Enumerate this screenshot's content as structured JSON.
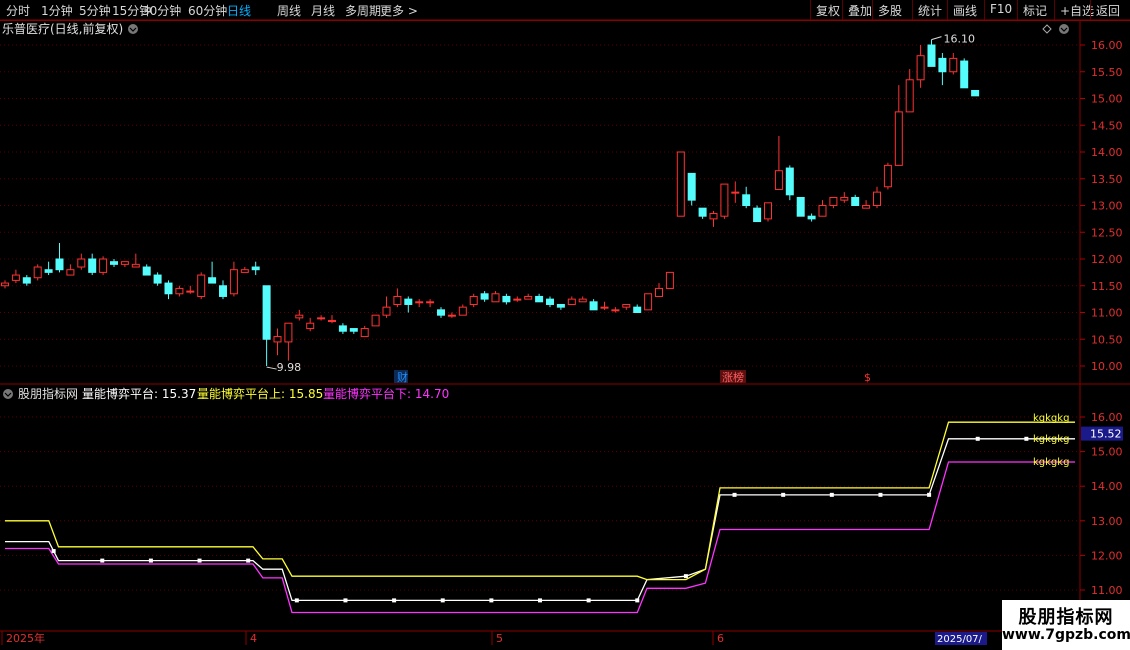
{
  "toolbar": {
    "periods": [
      "分时",
      "1分钟",
      "5分钟",
      "15分钟",
      "30分钟",
      "60分钟",
      "日线",
      "周线",
      "月线",
      "多周期",
      "更多"
    ],
    "active_period": "日线",
    "actions": [
      "复权",
      "叠加",
      "多股",
      "统计",
      "画线",
      "F10",
      "标记",
      "+自选",
      "返回"
    ]
  },
  "main_panel": {
    "title": "乐普医疗(日线,前复权)",
    "y_ticks": [
      "16.00",
      "15.50",
      "15.00",
      "14.50",
      "14.00",
      "13.50",
      "13.00",
      "12.50",
      "12.00",
      "11.50",
      "11.00",
      "10.50",
      "10.00"
    ],
    "high_label": "16.10",
    "low_label": "9.98",
    "markers": [
      {
        "label": "财",
        "color": "#1e90ff"
      },
      {
        "label": "涨榜",
        "color": "#ff6060"
      },
      {
        "label": "$",
        "color": "#ff3030"
      }
    ]
  },
  "indicator_panel": {
    "name": "股朋指标网",
    "line1_label": "量能博弈平台: 15.37",
    "line2_label": "量能博弈平台上: 15.85",
    "line3_label": "量能博弈平台下: 14.70",
    "y_ticks": [
      "16.00",
      "15.00",
      "14.00",
      "13.00",
      "12.00",
      "11.00"
    ],
    "current_value": "15.52",
    "end_tags": [
      "kgkgkg",
      "kgkgkg",
      "kgkgkg"
    ],
    "colors": {
      "line1": "#ffffff",
      "line2": "#ffff33",
      "line3": "#ff33ff"
    }
  },
  "x_axis": {
    "labels": [
      "2025年",
      "4",
      "5",
      "6"
    ],
    "cursor_label": "2025/07/"
  },
  "watermark": {
    "line1": "股朋指标网",
    "line2": "www.7gpzb.com"
  },
  "chart_data": {
    "type": "candlestick",
    "title": "乐普医疗(日线,前复权)",
    "ylim": [
      9.8,
      16.25
    ],
    "candles": [
      [
        11.5,
        11.55,
        11.6,
        11.45
      ],
      [
        11.6,
        11.7,
        11.8,
        11.55
      ],
      [
        11.65,
        11.55,
        11.7,
        11.5
      ],
      [
        11.65,
        11.85,
        11.9,
        11.6
      ],
      [
        11.8,
        11.75,
        11.95,
        11.7
      ],
      [
        12.0,
        11.8,
        12.3,
        11.75
      ],
      [
        11.7,
        11.8,
        11.9,
        11.7
      ],
      [
        11.85,
        12.0,
        12.1,
        11.8
      ],
      [
        12.0,
        11.75,
        12.1,
        11.7
      ],
      [
        11.75,
        12.0,
        12.05,
        11.7
      ],
      [
        11.95,
        11.9,
        12.0,
        11.85
      ],
      [
        11.9,
        11.95,
        11.95,
        11.85
      ],
      [
        11.85,
        11.9,
        12.1,
        11.85
      ],
      [
        11.85,
        11.7,
        11.9,
        11.7
      ],
      [
        11.7,
        11.55,
        11.75,
        11.5
      ],
      [
        11.55,
        11.35,
        11.6,
        11.25
      ],
      [
        11.35,
        11.45,
        11.5,
        11.3
      ],
      [
        11.4,
        11.4,
        11.5,
        11.35
      ],
      [
        11.3,
        11.7,
        11.75,
        11.25
      ],
      [
        11.65,
        11.55,
        11.95,
        11.55
      ],
      [
        11.5,
        11.3,
        11.6,
        11.25
      ],
      [
        11.35,
        11.8,
        11.95,
        11.3
      ],
      [
        11.75,
        11.8,
        11.85,
        11.75
      ],
      [
        11.85,
        11.8,
        11.95,
        11.7
      ],
      [
        11.5,
        10.5,
        11.5,
        10.0
      ],
      [
        10.45,
        10.55,
        10.7,
        10.2
      ],
      [
        10.45,
        10.8,
        10.8,
        10.1
      ],
      [
        10.9,
        10.95,
        11.05,
        10.85
      ],
      [
        10.7,
        10.8,
        10.9,
        10.65
      ],
      [
        10.9,
        10.9,
        10.95,
        10.85
      ],
      [
        10.85,
        10.85,
        10.95,
        10.8
      ],
      [
        10.75,
        10.65,
        10.8,
        10.6
      ],
      [
        10.7,
        10.65,
        10.7,
        10.6
      ],
      [
        10.55,
        10.7,
        10.75,
        10.55
      ],
      [
        10.75,
        10.95,
        10.95,
        10.75
      ],
      [
        10.95,
        11.1,
        11.3,
        10.9
      ],
      [
        11.15,
        11.3,
        11.45,
        11.1
      ],
      [
        11.25,
        11.15,
        11.3,
        11.0
      ],
      [
        11.2,
        11.2,
        11.25,
        11.1
      ],
      [
        11.2,
        11.2,
        11.25,
        11.1
      ],
      [
        11.05,
        10.95,
        11.1,
        10.9
      ],
      [
        10.95,
        10.95,
        11.0,
        10.9
      ],
      [
        10.95,
        11.1,
        11.15,
        10.95
      ],
      [
        11.15,
        11.3,
        11.35,
        11.1
      ],
      [
        11.35,
        11.25,
        11.4,
        11.2
      ],
      [
        11.2,
        11.35,
        11.4,
        11.2
      ],
      [
        11.3,
        11.2,
        11.35,
        11.15
      ],
      [
        11.25,
        11.25,
        11.3,
        11.2
      ],
      [
        11.25,
        11.3,
        11.35,
        11.25
      ],
      [
        11.3,
        11.2,
        11.35,
        11.2
      ],
      [
        11.25,
        11.15,
        11.3,
        11.1
      ],
      [
        11.15,
        11.1,
        11.15,
        11.05
      ],
      [
        11.15,
        11.25,
        11.3,
        11.15
      ],
      [
        11.2,
        11.25,
        11.3,
        11.2
      ],
      [
        11.2,
        11.05,
        11.25,
        11.05
      ],
      [
        11.1,
        11.1,
        11.2,
        11.05
      ],
      [
        11.05,
        11.05,
        11.1,
        11.0
      ],
      [
        11.1,
        11.15,
        11.15,
        11.05
      ],
      [
        11.1,
        11.0,
        11.15,
        11.0
      ],
      [
        11.05,
        11.35,
        11.35,
        11.05
      ],
      [
        11.3,
        11.45,
        11.55,
        11.3
      ],
      [
        11.45,
        11.75,
        11.75,
        11.45
      ],
      [
        12.8,
        14.0,
        14.0,
        12.8
      ],
      [
        13.6,
        13.1,
        13.6,
        13.0
      ],
      [
        12.95,
        12.8,
        12.95,
        12.75
      ],
      [
        12.75,
        12.85,
        12.9,
        12.6
      ],
      [
        12.8,
        13.4,
        13.4,
        12.75
      ],
      [
        13.25,
        13.25,
        13.45,
        13.05
      ],
      [
        13.2,
        13.0,
        13.35,
        12.95
      ],
      [
        12.95,
        12.7,
        13.0,
        12.7
      ],
      [
        12.75,
        13.05,
        13.05,
        12.7
      ],
      [
        13.3,
        13.65,
        14.3,
        13.3
      ],
      [
        13.7,
        13.2,
        13.75,
        13.1
      ],
      [
        13.15,
        12.8,
        13.15,
        12.8
      ],
      [
        12.8,
        12.75,
        12.85,
        12.7
      ],
      [
        12.8,
        13.0,
        13.1,
        12.8
      ],
      [
        13.0,
        13.15,
        13.15,
        12.95
      ],
      [
        13.1,
        13.15,
        13.25,
        13.05
      ],
      [
        13.15,
        13.0,
        13.2,
        13.0
      ],
      [
        12.95,
        13.0,
        13.1,
        12.95
      ],
      [
        13.0,
        13.25,
        13.35,
        12.95
      ],
      [
        13.35,
        13.75,
        13.8,
        13.3
      ],
      [
        13.75,
        14.75,
        15.25,
        13.75
      ],
      [
        14.75,
        15.35,
        15.55,
        14.75
      ],
      [
        15.35,
        15.8,
        16.0,
        15.2
      ],
      [
        16.0,
        15.6,
        16.1,
        15.6
      ],
      [
        15.75,
        15.5,
        15.85,
        15.25
      ],
      [
        15.5,
        15.75,
        15.85,
        15.45
      ],
      [
        15.7,
        15.2,
        15.75,
        15.2
      ],
      [
        15.15,
        15.05,
        15.15,
        15.05
      ]
    ],
    "series": [
      {
        "name": "量能博弈平台",
        "color": "#ffffff",
        "steps": [
          [
            0,
            12.4
          ],
          [
            9,
            12.4
          ],
          [
            11,
            11.85
          ],
          [
            51,
            11.85
          ],
          [
            53,
            11.6
          ],
          [
            57,
            11.6
          ],
          [
            59,
            10.7
          ],
          [
            130,
            10.7
          ],
          [
            132,
            11.3
          ],
          [
            140,
            11.4
          ],
          [
            144,
            11.6
          ],
          [
            147,
            13.75
          ],
          [
            190,
            13.75
          ],
          [
            194,
            15.37
          ],
          [
            220,
            15.37
          ]
        ]
      },
      {
        "name": "量能博弈平台上",
        "color": "#ffff33",
        "steps": [
          [
            0,
            13.0
          ],
          [
            9,
            13.0
          ],
          [
            11,
            12.25
          ],
          [
            51,
            12.25
          ],
          [
            53,
            11.9
          ],
          [
            57,
            11.9
          ],
          [
            59,
            11.4
          ],
          [
            130,
            11.4
          ],
          [
            132,
            11.3
          ],
          [
            140,
            11.3
          ],
          [
            144,
            11.6
          ],
          [
            147,
            13.95
          ],
          [
            190,
            13.95
          ],
          [
            194,
            15.85
          ],
          [
            220,
            15.85
          ]
        ]
      },
      {
        "name": "量能博弈平台下",
        "color": "#ff33ff",
        "steps": [
          [
            0,
            12.2
          ],
          [
            9,
            12.2
          ],
          [
            11,
            11.75
          ],
          [
            51,
            11.75
          ],
          [
            53,
            11.35
          ],
          [
            57,
            11.35
          ],
          [
            59,
            10.35
          ],
          [
            130,
            10.35
          ],
          [
            132,
            11.05
          ],
          [
            140,
            11.05
          ],
          [
            144,
            11.2
          ],
          [
            147,
            12.75
          ],
          [
            190,
            12.75
          ],
          [
            194,
            14.7
          ],
          [
            220,
            14.7
          ]
        ]
      }
    ],
    "indicator_ylim": [
      10.7,
      16.2
    ]
  }
}
